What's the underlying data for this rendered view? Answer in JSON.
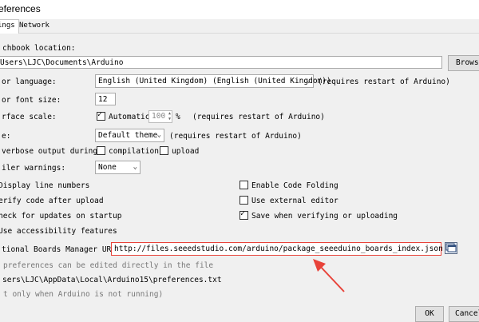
{
  "window": {
    "title": "eferences"
  },
  "tabs": [
    {
      "label": "ings",
      "active": true
    },
    {
      "label": "Network",
      "active": false
    }
  ],
  "sketchbook": {
    "label": "chbook location:",
    "value": "Users\\LJC\\Documents\\Arduino",
    "browse_label": "Browse"
  },
  "language": {
    "label": "or language:",
    "value": "English (United Kingdom) (English (United Kingdom))",
    "note": "(requires restart of Arduino)"
  },
  "font_size": {
    "label": "or font size:",
    "value": "12"
  },
  "interface_scale": {
    "label": "rface scale:",
    "automatic_label": "Automatic",
    "automatic_checked": true,
    "value": "100",
    "unit": "%",
    "note": "(requires restart of Arduino)"
  },
  "theme": {
    "label": "e:",
    "value": "Default theme",
    "note": "(requires restart of Arduino)"
  },
  "verbose": {
    "label": "verbose output during:",
    "compilation_label": "compilation",
    "compilation_checked": false,
    "upload_label": "upload",
    "upload_checked": false
  },
  "compiler_warnings": {
    "label": "iler warnings:",
    "value": "None"
  },
  "options_left": [
    {
      "label": "Display line numbers",
      "checked": false
    },
    {
      "label": "erify code after upload",
      "checked": false
    },
    {
      "label": "heck for updates on startup",
      "checked": false
    },
    {
      "label": "Use accessibility features",
      "checked": false
    }
  ],
  "options_right": [
    {
      "label": "Enable Code Folding",
      "checked": false
    },
    {
      "label": "Use external editor",
      "checked": false
    },
    {
      "label": "Save when verifying or uploading",
      "checked": true
    }
  ],
  "boards_manager": {
    "label": "tional Boards Manager URLs:",
    "value": "http://files.seeedstudio.com/arduino/package_seeeduino_boards_index.json"
  },
  "footer": {
    "edit_note": "preferences can be edited directly in the file",
    "prefs_path": "sers\\LJC\\AppData\\Local\\Arduino15\\preferences.txt",
    "running_note": "t only when Arduino is not running)"
  },
  "buttons": {
    "ok": "OK",
    "cancel": "Cancel"
  },
  "colors": {
    "highlight": "#e8433a",
    "background": "#f0f0f0"
  },
  "icons": {
    "url_editor": "window-edit-icon",
    "annotation": "red-arrow-icon"
  }
}
